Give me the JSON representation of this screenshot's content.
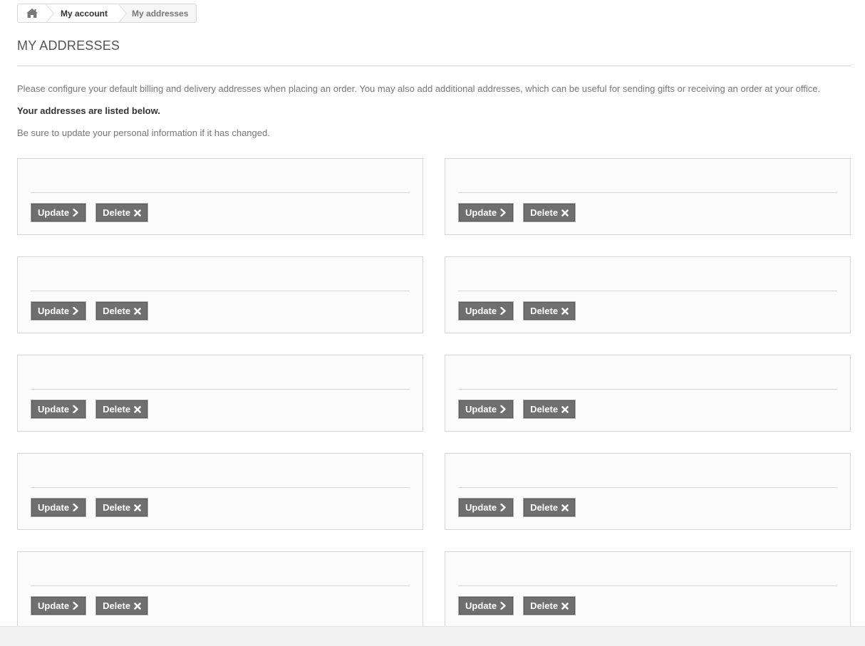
{
  "breadcrumb": {
    "home_icon": "home-icon",
    "account_label": "My account",
    "current_label": "My addresses"
  },
  "heading": "MY ADDRESSES",
  "info": {
    "line1": "Please configure your default billing and delivery addresses when placing an order. You may also add additional addresses, which can be useful for sending gifts or receiving an order at your office.",
    "line2": "Your addresses are listed below.",
    "line3": "Be sure to update your personal information if it has changed."
  },
  "buttons": {
    "update_label": "Update",
    "update_icon": "chevron-right-icon",
    "delete_label": "Delete",
    "delete_icon": "close-icon"
  },
  "addresses_count": 10,
  "colors": {
    "button_bg": "#6f6f6f",
    "border": "#d6d4d4",
    "box_bg": "#fbfbfb",
    "heading": "#555454"
  }
}
